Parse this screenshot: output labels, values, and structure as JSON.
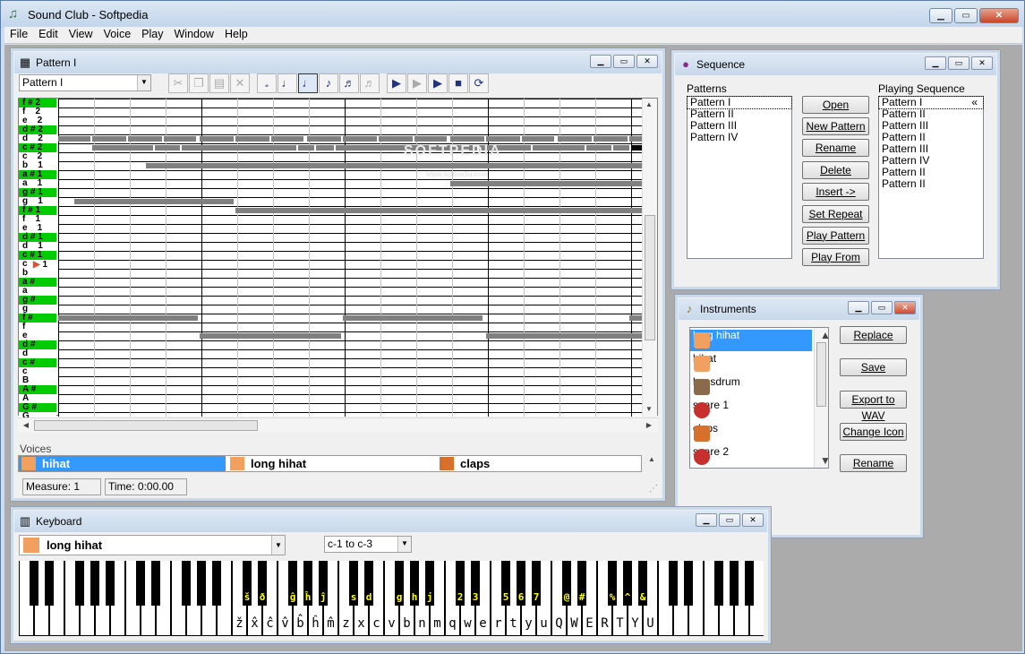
{
  "app": {
    "title": "Sound Club - Softpedia",
    "menu": [
      "File",
      "Edit",
      "View",
      "Voice",
      "Play",
      "Window",
      "Help"
    ]
  },
  "pattern": {
    "title": "Pattern I",
    "selected": "Pattern I",
    "notes": [
      "f # 2",
      "f    2",
      "e    2",
      "d # 2",
      "d    2",
      "c # 2",
      "c    2",
      "b    1",
      "a # 1",
      "a    1",
      "g # 1",
      "g    1",
      "f # 1",
      "f    1",
      "e    1",
      "d # 1",
      "d    1",
      "c # 1",
      "c",
      "b",
      "a #",
      "a",
      "g #",
      "g",
      "f #",
      "f",
      "e",
      "d #",
      "d",
      "c #",
      "c",
      "B",
      "A #",
      "A",
      "G #",
      "G"
    ],
    "sharp_rows": [
      0,
      3,
      5,
      8,
      10,
      12,
      15,
      17,
      20,
      22,
      24,
      27,
      29,
      32,
      34
    ],
    "c_marker": "1",
    "watermark": "SOFTPEDIA",
    "watermark_url": "www.softpedia.com"
  },
  "voices": {
    "label": "Voices",
    "items": [
      "hihat",
      "long hihat",
      "claps"
    ],
    "measure": "Measure: 1",
    "time": "Time: 0:00.00"
  },
  "sequence": {
    "title": "Sequence",
    "patterns_label": "Patterns",
    "patterns": [
      "Pattern I",
      "Pattern II",
      "Pattern III",
      "Pattern IV"
    ],
    "playing_label": "Playing Sequence",
    "playing": [
      "Pattern I",
      "Pattern II",
      "Pattern III",
      "Pattern II",
      "Pattern III",
      "Pattern IV",
      "Pattern II",
      "Pattern II"
    ],
    "playing_marker": "«",
    "buttons": [
      "Open",
      "New Pattern",
      "Rename",
      "Delete",
      "Insert ->",
      "Set Repeat",
      "Play Pattern",
      "Play From"
    ]
  },
  "instruments": {
    "title": "Instruments",
    "items": [
      "long hihat",
      "hihat",
      "bassdrum",
      "snare 1",
      "claps",
      "snare 2"
    ],
    "buttons": [
      "Replace",
      "Save",
      "Export to WAV",
      "Change Icon",
      "Rename"
    ]
  },
  "keyboard": {
    "title": "Keyboard",
    "instrument": "long hihat",
    "range": "c-1 to c-3",
    "black_labels": [
      "š",
      "ð",
      "ĝ",
      "ĥ",
      "ĵ",
      "s",
      "d",
      "g",
      "h",
      "j",
      "2",
      "3",
      "5",
      "6",
      "7",
      "@",
      "#",
      "%",
      "^",
      "&"
    ],
    "white_labels": [
      "ž",
      "x̂",
      "ĉ",
      "v̂",
      "b̂",
      "ĥ",
      "m̂",
      "z",
      "x",
      "c",
      "v",
      "b",
      "n",
      "m",
      "q",
      "w",
      "e",
      "r",
      "t",
      "y",
      "u",
      "Q",
      "W",
      "E",
      "R",
      "T",
      "Y",
      "U"
    ]
  },
  "colors": {
    "note_sharp": "#00cc00",
    "bar": "#808080",
    "selection": "#3399ff"
  }
}
